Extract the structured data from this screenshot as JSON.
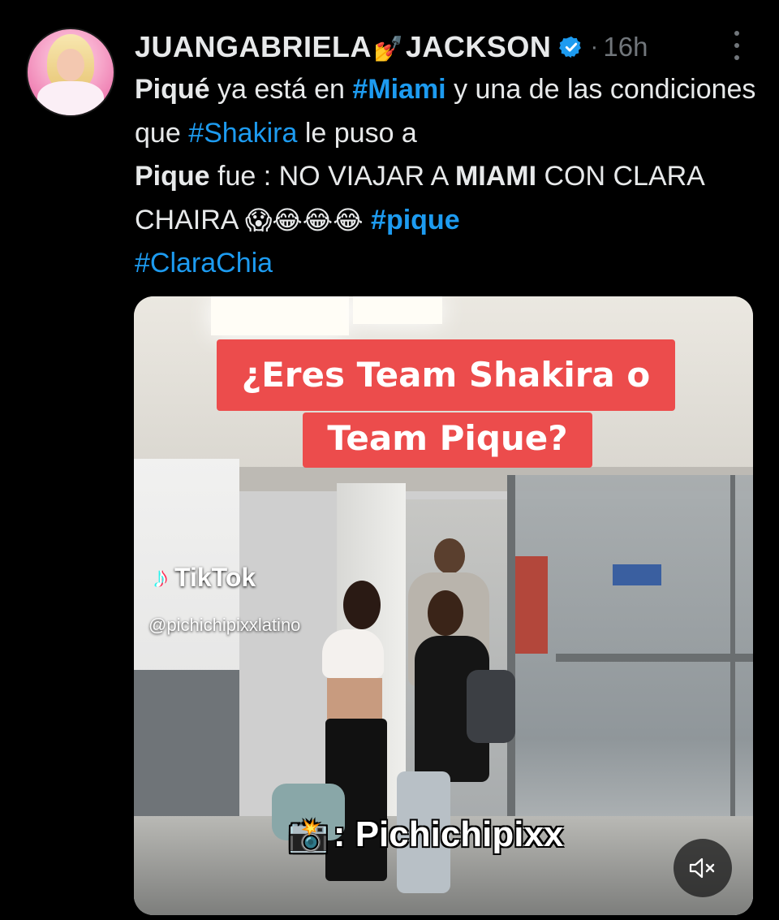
{
  "tweet": {
    "author_name_part1": "JUANGABRIELA",
    "author_emoji": "💅",
    "author_name_part2": "JACKSON",
    "separator": "·",
    "timestamp": "16h",
    "text": {
      "w1": "Piqué",
      "w2": " ya está en ",
      "h1": "#Miami",
      "w3": " y una de las condiciones que ",
      "h2": "#Shakira",
      "w4": " le puso a ",
      "w5": "Pique",
      "w6": " fue : NO VIAJAR A ",
      "w7": "MIAMI",
      "w8": " CON CLARA CHAIRA ",
      "emojis": "😱😂😂😂",
      "h3": "#pique",
      "h4": "#ClaraChia"
    }
  },
  "media": {
    "caption_line1": "¿Eres Team Shakira o",
    "caption_line2": "Team Pique?",
    "tiktok_brand": "TikTok",
    "tiktok_handle": "@pichichipixxlatino",
    "camera_emoji": "📸",
    "credit": ": Pichichipixx"
  },
  "icons": [
    "avatar",
    "verified-badge-icon",
    "more-options-icon",
    "tiktok-logo-icon",
    "mute-icon"
  ],
  "colors": {
    "accent": "#1d9bf0",
    "caption_bg": "#ec4c4c",
    "muted": "#71767b"
  }
}
